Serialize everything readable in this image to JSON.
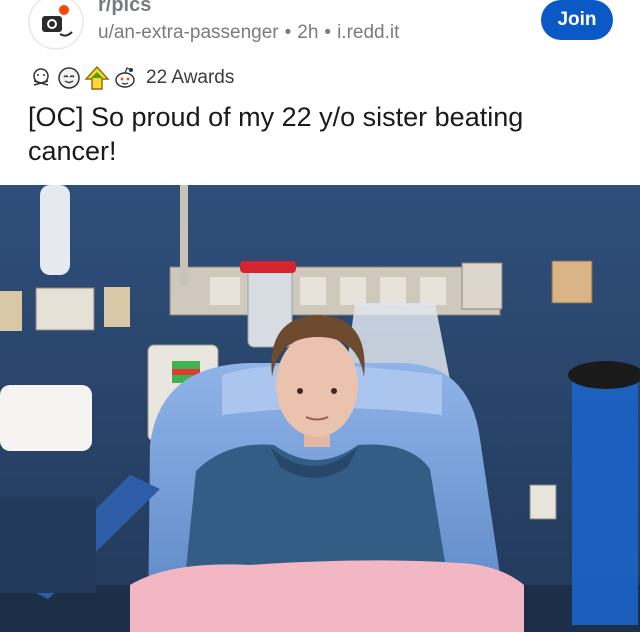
{
  "post": {
    "subreddit": "r/pics",
    "author": "u/an-extra-passenger",
    "age": "2h",
    "domain": "i.redd.it",
    "join_label": "Join",
    "awards_label": "22 Awards",
    "title": "[OC] So proud of my 22 y/o sister beating cancer!"
  },
  "icons": [
    "subreddit-avatar-icon",
    "award-hug-icon",
    "award-wholesome-icon",
    "award-up-arrow-icon",
    "award-snoo-icon"
  ],
  "colors": {
    "join_button": "#0a59c7",
    "meta_text": "#787c7e",
    "title_text": "#1a1a1b"
  }
}
